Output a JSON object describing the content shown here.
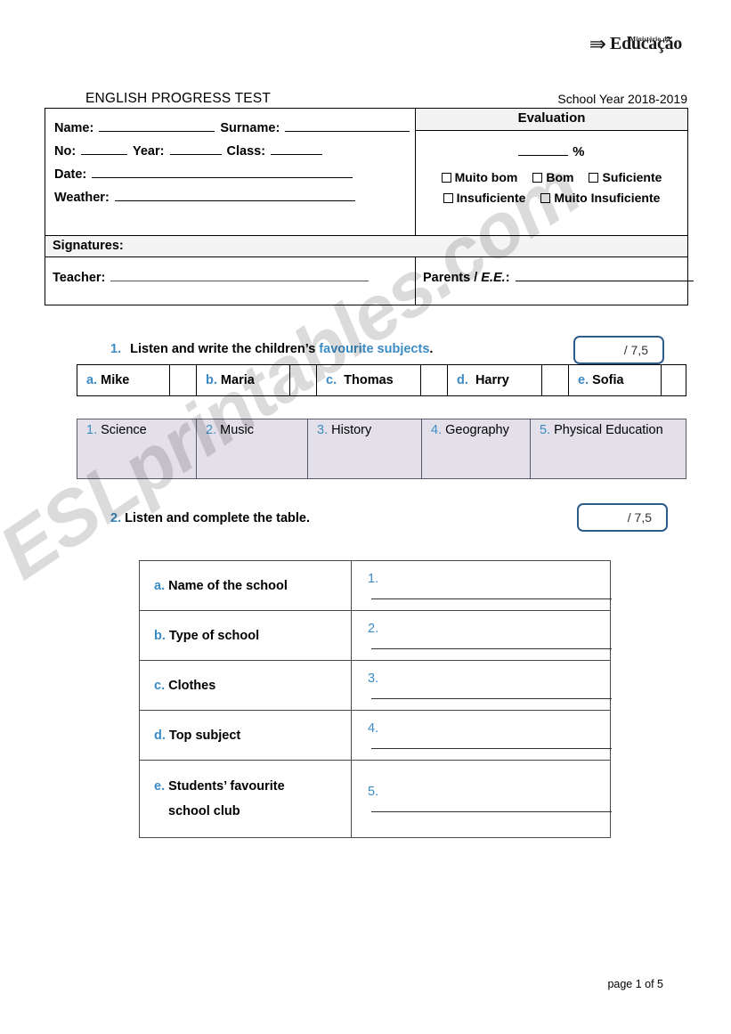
{
  "logo": {
    "mark": "\u0001",
    "ministerio": "Ministério  da",
    "educacao": "Educação"
  },
  "header": {
    "test_title": "ENGLISH PROGRESS TEST",
    "school_year": "School Year 2018-2019"
  },
  "student_info": {
    "name_label": "Name:",
    "surname_label": "Surname:",
    "no_label": "No:",
    "year_label": "Year:",
    "class_label": "Class:",
    "date_label": "Date:",
    "weather_label": "Weather:"
  },
  "evaluation": {
    "title": "Evaluation",
    "percent_symbol": "%",
    "grades_row1": [
      "Muito bom",
      "Bom",
      "Suficiente"
    ],
    "grades_row2": [
      "Insuficiente",
      "Muito Insuficiente"
    ]
  },
  "signatures": {
    "title": "Signatures:",
    "teacher_label": "Teacher:",
    "parents_label_pre": "Parents / ",
    "parents_label_em": "E.E.",
    "parents_label_post": ":"
  },
  "exercise1": {
    "number": "1.",
    "text_pre": "Listen and write the children’s ",
    "text_highlight": "favourite subjects",
    "text_post": ".",
    "score": "/ 7,5",
    "children": [
      {
        "letter": "a.",
        "name": "Mike"
      },
      {
        "letter": "b.",
        "name": "Maria"
      },
      {
        "letter": "c.",
        "name": "Thomas"
      },
      {
        "letter": "d.",
        "name": "Harry"
      },
      {
        "letter": "e.",
        "name": "Sofia"
      }
    ],
    "subjects": [
      {
        "number": "1.",
        "name": "Science"
      },
      {
        "number": "2.",
        "name": "Music"
      },
      {
        "number": "3.",
        "name": "History"
      },
      {
        "number": "4.",
        "name": "Geography"
      },
      {
        "number": "5.",
        "name": "Physical Education"
      }
    ]
  },
  "exercise2": {
    "number": "2.",
    "text": "Listen and complete the table.",
    "score": "/ 7,5",
    "rows": [
      {
        "letter": "a.",
        "label": "Name of the school",
        "label_line2": "",
        "answer_number": "1."
      },
      {
        "letter": "b.",
        "label": "Type of school",
        "label_line2": "",
        "answer_number": "2."
      },
      {
        "letter": "c.",
        "label": "Clothes",
        "label_line2": "",
        "answer_number": "3."
      },
      {
        "letter": "d.",
        "label": "Top subject",
        "label_line2": "",
        "answer_number": "4."
      },
      {
        "letter": "e.",
        "label": "Students’ favourite",
        "label_line2": "school club",
        "answer_number": "5."
      }
    ]
  },
  "footer": {
    "page_text": "page 1 of 5"
  },
  "colors": {
    "accent_blue": "#3b8bc4",
    "score_border": "#2e5c8a",
    "subject_row_bg": "#e4e0ea",
    "header_fill": "#f2f2f2"
  },
  "watermark": {
    "text": "ESLprintables.com"
  }
}
